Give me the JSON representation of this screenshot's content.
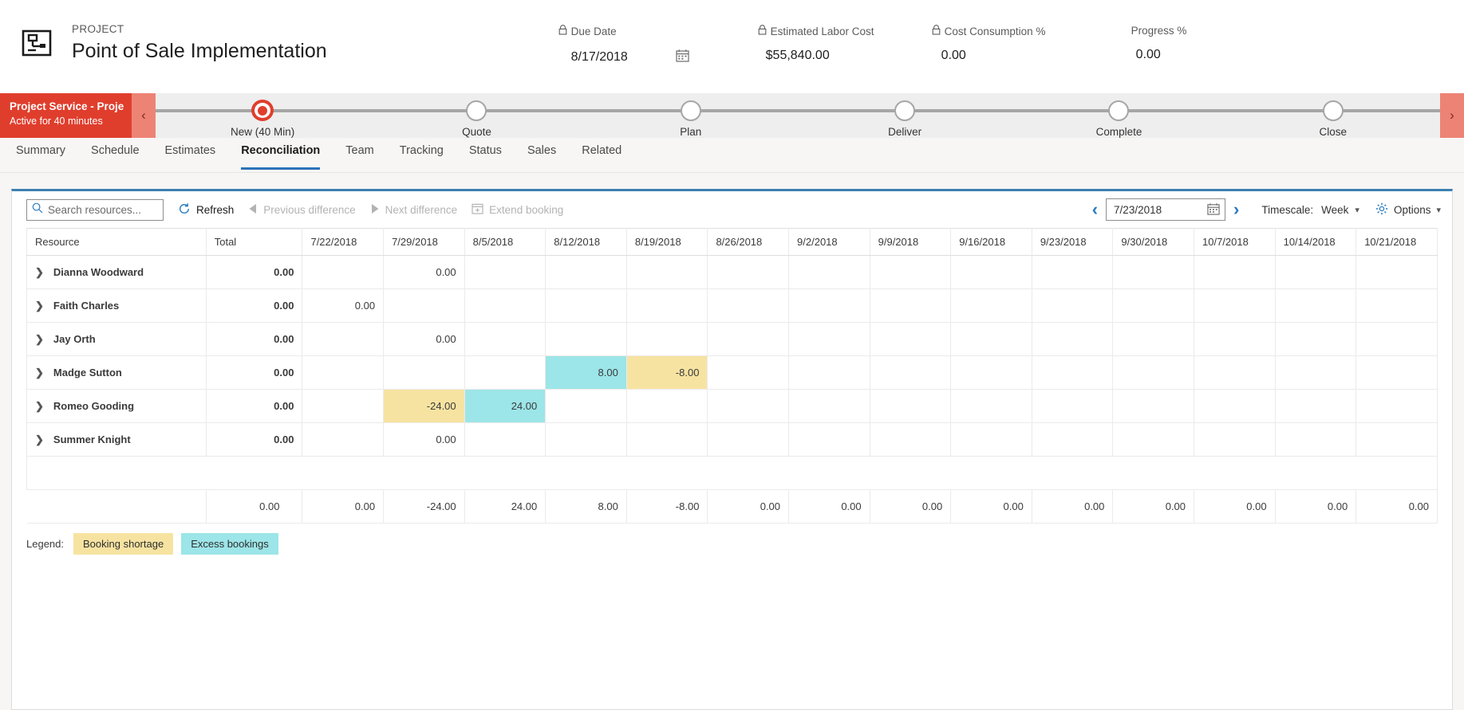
{
  "header": {
    "kicker": "PROJECT",
    "title": "Point of Sale Implementation",
    "project_icon": "project-blueprint-icon",
    "metrics": [
      {
        "label": "Due Date",
        "value": "8/17/2018",
        "locked": true,
        "icon": "lock-icon",
        "trailing_icon": "calendar-icon"
      },
      {
        "label": "Estimated Labor Cost",
        "value": "$55,840.00",
        "locked": true,
        "icon": "lock-icon"
      },
      {
        "label": "Cost Consumption %",
        "value": "0.00",
        "locked": true,
        "icon": "lock-icon"
      },
      {
        "label": "Progress %",
        "value": "0.00",
        "locked": false
      }
    ]
  },
  "process_flow": {
    "name": "Project Service - Project ...",
    "status": "Active for 40 minutes",
    "prev_icon": "chevron-left-icon",
    "next_icon": "chevron-right-icon",
    "active_stage": "New  (40 Min)",
    "stages": [
      {
        "label": "New  (40 Min)",
        "active": true
      },
      {
        "label": "Quote",
        "active": false
      },
      {
        "label": "Plan",
        "active": false
      },
      {
        "label": "Deliver",
        "active": false
      },
      {
        "label": "Complete",
        "active": false
      },
      {
        "label": "Close",
        "active": false
      }
    ],
    "accent_color": "#e03e2d"
  },
  "tabs": [
    {
      "label": "Summary",
      "active": false
    },
    {
      "label": "Schedule",
      "active": false
    },
    {
      "label": "Estimates",
      "active": false
    },
    {
      "label": "Reconciliation",
      "active": true
    },
    {
      "label": "Team",
      "active": false
    },
    {
      "label": "Tracking",
      "active": false
    },
    {
      "label": "Status",
      "active": false
    },
    {
      "label": "Sales",
      "active": false
    },
    {
      "label": "Related",
      "active": false
    }
  ],
  "toolbar": {
    "search": {
      "placeholder": "Search resources...",
      "value": "",
      "icon": "search-icon"
    },
    "refresh": {
      "label": "Refresh",
      "icon": "refresh-icon",
      "disabled": false
    },
    "previous_difference": {
      "label": "Previous difference",
      "icon": "triangle-left-icon",
      "disabled": true
    },
    "next_difference": {
      "label": "Next difference",
      "icon": "triangle-right-icon",
      "disabled": true
    },
    "extend_booking": {
      "label": "Extend booking",
      "icon": "extend-booking-icon",
      "disabled": true
    },
    "date_prev_icon": "chevron-left-icon",
    "date_next_icon": "chevron-right-icon",
    "date_value": "7/23/2018",
    "date_icon": "calendar-icon",
    "timescale_label": "Timescale:",
    "timescale_value": "Week",
    "options_label": "Options",
    "options_icon": "gear-icon",
    "caret_icon": "chevron-down-icon"
  },
  "grid": {
    "columns": [
      "Resource",
      "Total",
      "7/22/2018",
      "7/29/2018",
      "8/5/2018",
      "8/12/2018",
      "8/19/2018",
      "8/26/2018",
      "9/2/2018",
      "9/9/2018",
      "9/16/2018",
      "9/23/2018",
      "9/30/2018",
      "10/7/2018",
      "10/14/2018",
      "10/21/2018"
    ],
    "expand_icon": "chevron-right-icon",
    "rows": [
      {
        "resource": "Dianna Woodward",
        "total": "0.00",
        "cells": [
          {
            "v": ""
          },
          {
            "v": "0.00"
          },
          {
            "v": ""
          },
          {
            "v": ""
          },
          {
            "v": ""
          },
          {
            "v": ""
          },
          {
            "v": ""
          },
          {
            "v": ""
          },
          {
            "v": ""
          },
          {
            "v": ""
          },
          {
            "v": ""
          },
          {
            "v": ""
          },
          {
            "v": ""
          },
          {
            "v": ""
          }
        ]
      },
      {
        "resource": "Faith Charles",
        "total": "0.00",
        "cells": [
          {
            "v": "0.00"
          },
          {
            "v": ""
          },
          {
            "v": ""
          },
          {
            "v": ""
          },
          {
            "v": ""
          },
          {
            "v": ""
          },
          {
            "v": ""
          },
          {
            "v": ""
          },
          {
            "v": ""
          },
          {
            "v": ""
          },
          {
            "v": ""
          },
          {
            "v": ""
          },
          {
            "v": ""
          },
          {
            "v": ""
          }
        ]
      },
      {
        "resource": "Jay Orth",
        "total": "0.00",
        "cells": [
          {
            "v": ""
          },
          {
            "v": "0.00"
          },
          {
            "v": ""
          },
          {
            "v": ""
          },
          {
            "v": ""
          },
          {
            "v": ""
          },
          {
            "v": ""
          },
          {
            "v": ""
          },
          {
            "v": ""
          },
          {
            "v": ""
          },
          {
            "v": ""
          },
          {
            "v": ""
          },
          {
            "v": ""
          },
          {
            "v": ""
          }
        ]
      },
      {
        "resource": "Madge Sutton",
        "total": "0.00",
        "cells": [
          {
            "v": ""
          },
          {
            "v": ""
          },
          {
            "v": ""
          },
          {
            "v": "8.00",
            "hl": "excess"
          },
          {
            "v": "-8.00",
            "hl": "short"
          },
          {
            "v": ""
          },
          {
            "v": ""
          },
          {
            "v": ""
          },
          {
            "v": ""
          },
          {
            "v": ""
          },
          {
            "v": ""
          },
          {
            "v": ""
          },
          {
            "v": ""
          },
          {
            "v": ""
          }
        ]
      },
      {
        "resource": "Romeo Gooding",
        "total": "0.00",
        "cells": [
          {
            "v": ""
          },
          {
            "v": "-24.00",
            "hl": "short"
          },
          {
            "v": "24.00",
            "hl": "excess"
          },
          {
            "v": ""
          },
          {
            "v": ""
          },
          {
            "v": ""
          },
          {
            "v": ""
          },
          {
            "v": ""
          },
          {
            "v": ""
          },
          {
            "v": ""
          },
          {
            "v": ""
          },
          {
            "v": ""
          },
          {
            "v": ""
          },
          {
            "v": ""
          }
        ]
      },
      {
        "resource": "Summer Knight",
        "total": "0.00",
        "cells": [
          {
            "v": ""
          },
          {
            "v": "0.00"
          },
          {
            "v": ""
          },
          {
            "v": ""
          },
          {
            "v": ""
          },
          {
            "v": ""
          },
          {
            "v": ""
          },
          {
            "v": ""
          },
          {
            "v": ""
          },
          {
            "v": ""
          },
          {
            "v": ""
          },
          {
            "v": ""
          },
          {
            "v": ""
          },
          {
            "v": ""
          }
        ]
      }
    ],
    "totals_row": {
      "resource": "",
      "total": "0.00",
      "cells": [
        "0.00",
        "-24.00",
        "24.00",
        "8.00",
        "-8.00",
        "0.00",
        "0.00",
        "0.00",
        "0.00",
        "0.00",
        "0.00",
        "0.00",
        "0.00",
        "0.00"
      ]
    }
  },
  "legend": {
    "label": "Legend:",
    "items": [
      {
        "label": "Booking shortage",
        "color": "#f7e3a1"
      },
      {
        "label": "Excess bookings",
        "color": "#9ce5e8"
      }
    ]
  }
}
